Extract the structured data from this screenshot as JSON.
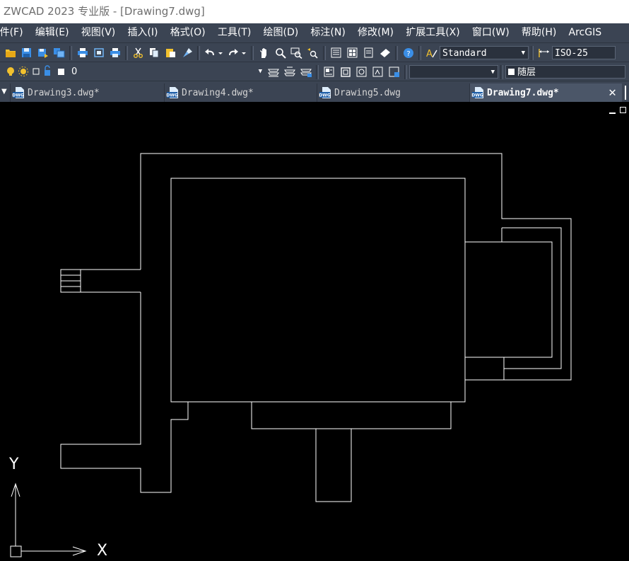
{
  "window": {
    "title": "ZWCAD 2023 专业版 - [Drawing7.dwg]"
  },
  "menu": [
    "件(F)",
    "编辑(E)",
    "视图(V)",
    "插入(I)",
    "格式(O)",
    "工具(T)",
    "绘图(D)",
    "标注(N)",
    "修改(M)",
    "扩展工具(X)",
    "窗口(W)",
    "帮助(H)",
    "ArcGIS"
  ],
  "toolbar1": {
    "icons": [
      "open-icon",
      "save-icon",
      "save-as-icon",
      "publish-icon",
      "print-icon",
      "print-preview-icon",
      "plot-icon",
      "cut-icon",
      "copy-icon",
      "paste-icon",
      "match-properties-icon",
      "undo-icon",
      "redo-icon",
      "pan-icon",
      "zoom-realtime-icon",
      "zoom-window-icon",
      "zoom-previous-icon",
      "properties-icon",
      "design-center-icon",
      "tool-palette-icon",
      "markup-icon",
      "help-icon"
    ],
    "text_style": "Standard",
    "dim_style": "ISO-25"
  },
  "toolbar2": {
    "layer_name": "0",
    "color_value": "随层",
    "linetype_value": ""
  },
  "tabs": [
    {
      "label": "Drawing3.dwg*",
      "active": false
    },
    {
      "label": "Drawing4.dwg*",
      "active": false
    },
    {
      "label": "Drawing5.dwg",
      "active": false
    },
    {
      "label": "Drawing7.dwg*",
      "active": true
    }
  ],
  "ucs": {
    "x_label": "X",
    "y_label": "Y"
  },
  "colors": {
    "canvas": "#000000",
    "lines": "#ffffff",
    "chrome": "#3b4453",
    "accent_blue": "#3a8ee6",
    "icon_yellow": "#f2c12e"
  }
}
